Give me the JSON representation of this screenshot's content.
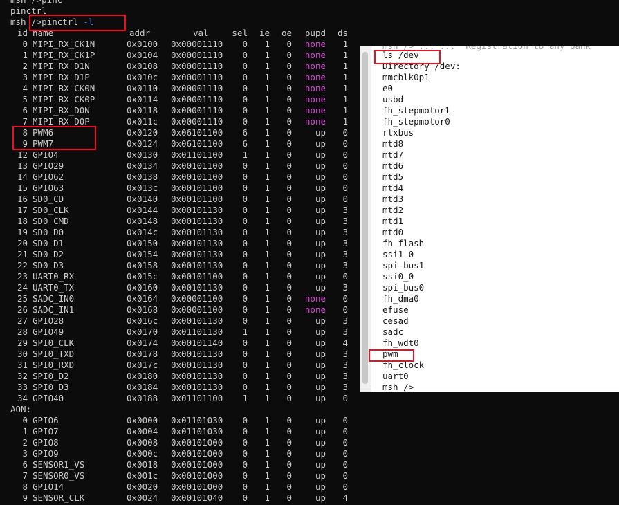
{
  "terminal": {
    "top_lines": [
      "msh />pinc",
      "pinctrl"
    ],
    "prompt": "msh ",
    "command_path": "/>pinctrl ",
    "command_flag": "-l",
    "header": [
      "id",
      "name",
      "addr",
      "val",
      "sel",
      "ie",
      "oe",
      "pupd",
      "ds"
    ],
    "rows": [
      [
        "0",
        "MIPI_RX_CK1N",
        "0x0100",
        "0x00001110",
        "0",
        "1",
        "0",
        "none",
        "1"
      ],
      [
        "1",
        "MIPI_RX_CK1P",
        "0x0104",
        "0x00001110",
        "0",
        "1",
        "0",
        "none",
        "1"
      ],
      [
        "2",
        "MIPI_RX_D1N",
        "0x0108",
        "0x00001110",
        "0",
        "1",
        "0",
        "none",
        "1"
      ],
      [
        "3",
        "MIPI_RX_D1P",
        "0x010c",
        "0x00001110",
        "0",
        "1",
        "0",
        "none",
        "1"
      ],
      [
        "4",
        "MIPI_RX_CK0N",
        "0x0110",
        "0x00001110",
        "0",
        "1",
        "0",
        "none",
        "1"
      ],
      [
        "5",
        "MIPI_RX_CK0P",
        "0x0114",
        "0x00001110",
        "0",
        "1",
        "0",
        "none",
        "1"
      ],
      [
        "6",
        "MIPI_RX_D0N",
        "0x0118",
        "0x00001110",
        "0",
        "1",
        "0",
        "none",
        "1"
      ],
      [
        "7",
        "MIPI_RX_D0P",
        "0x011c",
        "0x00001110",
        "0",
        "1",
        "0",
        "none",
        "1"
      ],
      [
        "8",
        "PWM6",
        "0x0120",
        "0x06101100",
        "6",
        "1",
        "0",
        "up",
        "0"
      ],
      [
        "9",
        "PWM7",
        "0x0124",
        "0x06101100",
        "6",
        "1",
        "0",
        "up",
        "0"
      ],
      [
        "12",
        "GPIO4",
        "0x0130",
        "0x01101100",
        "1",
        "1",
        "0",
        "up",
        "0"
      ],
      [
        "13",
        "GPIO29",
        "0x0134",
        "0x00101100",
        "0",
        "1",
        "0",
        "up",
        "0"
      ],
      [
        "14",
        "GPIO62",
        "0x0138",
        "0x00101100",
        "0",
        "1",
        "0",
        "up",
        "0"
      ],
      [
        "15",
        "GPIO63",
        "0x013c",
        "0x00101100",
        "0",
        "1",
        "0",
        "up",
        "0"
      ],
      [
        "16",
        "SD0_CD",
        "0x0140",
        "0x00101100",
        "0",
        "1",
        "0",
        "up",
        "0"
      ],
      [
        "17",
        "SD0_CLK",
        "0x0144",
        "0x00101130",
        "0",
        "1",
        "0",
        "up",
        "3"
      ],
      [
        "18",
        "SD0_CMD",
        "0x0148",
        "0x00101130",
        "0",
        "1",
        "0",
        "up",
        "3"
      ],
      [
        "19",
        "SD0_D0",
        "0x014c",
        "0x00101130",
        "0",
        "1",
        "0",
        "up",
        "3"
      ],
      [
        "20",
        "SD0_D1",
        "0x0150",
        "0x00101130",
        "0",
        "1",
        "0",
        "up",
        "3"
      ],
      [
        "21",
        "SD0_D2",
        "0x0154",
        "0x00101130",
        "0",
        "1",
        "0",
        "up",
        "3"
      ],
      [
        "22",
        "SD0_D3",
        "0x0158",
        "0x00101130",
        "0",
        "1",
        "0",
        "up",
        "3"
      ],
      [
        "23",
        "UART0_RX",
        "0x015c",
        "0x00101100",
        "0",
        "1",
        "0",
        "up",
        "0"
      ],
      [
        "24",
        "UART0_TX",
        "0x0160",
        "0x00101130",
        "0",
        "1",
        "0",
        "up",
        "3"
      ],
      [
        "25",
        "SADC_IN0",
        "0x0164",
        "0x00001100",
        "0",
        "1",
        "0",
        "none",
        "0"
      ],
      [
        "26",
        "SADC_IN1",
        "0x0168",
        "0x00001100",
        "0",
        "1",
        "0",
        "none",
        "0"
      ],
      [
        "27",
        "GPIO28",
        "0x016c",
        "0x00101130",
        "0",
        "1",
        "0",
        "up",
        "3"
      ],
      [
        "28",
        "GPIO49",
        "0x0170",
        "0x01101130",
        "1",
        "1",
        "0",
        "up",
        "3"
      ],
      [
        "29",
        "SPI0_CLK",
        "0x0174",
        "0x00101140",
        "0",
        "1",
        "0",
        "up",
        "4"
      ],
      [
        "30",
        "SPI0_TXD",
        "0x0178",
        "0x00101130",
        "0",
        "1",
        "0",
        "up",
        "3"
      ],
      [
        "31",
        "SPI0_RXD",
        "0x017c",
        "0x00101130",
        "0",
        "1",
        "0",
        "up",
        "3"
      ],
      [
        "32",
        "SPI0_D2",
        "0x0180",
        "0x00101130",
        "0",
        "1",
        "0",
        "up",
        "3"
      ],
      [
        "33",
        "SPI0_D3",
        "0x0184",
        "0x00101130",
        "0",
        "1",
        "0",
        "up",
        "3"
      ],
      [
        "34",
        "GPIO40",
        "0x0188",
        "0x01101100",
        "1",
        "1",
        "0",
        "up",
        "0"
      ]
    ],
    "aon_label": "AON:",
    "aon_rows": [
      [
        "0",
        "GPIO6",
        "0x0000",
        "0x01101030",
        "0",
        "1",
        "0",
        "up",
        "0"
      ],
      [
        "1",
        "GPIO7",
        "0x0004",
        "0x01101030",
        "0",
        "1",
        "0",
        "up",
        "0"
      ],
      [
        "2",
        "GPIO8",
        "0x0008",
        "0x00101000",
        "0",
        "1",
        "0",
        "up",
        "0"
      ],
      [
        "3",
        "GPIO9",
        "0x000c",
        "0x00101000",
        "0",
        "1",
        "0",
        "up",
        "0"
      ],
      [
        "6",
        "SENSOR1_VS",
        "0x0018",
        "0x00101000",
        "0",
        "1",
        "0",
        "up",
        "0"
      ],
      [
        "7",
        "SENSOR0_VS",
        "0x001c",
        "0x00101000",
        "0",
        "1",
        "0",
        "up",
        "0"
      ],
      [
        "8",
        "GPIO14",
        "0x0020",
        "0x00101000",
        "0",
        "1",
        "0",
        "up",
        "0"
      ],
      [
        "9",
        "SENSOR_CLK",
        "0x0024",
        "0x00101040",
        "0",
        "1",
        "0",
        "up",
        "4"
      ]
    ]
  },
  "dev_panel": {
    "cut_line": "msh /> ... ...  Registration to any bank",
    "command": "ls /dev",
    "listing_title": "Directory /dev:",
    "entries": [
      "mmcblk0p1",
      "e0",
      "usbd",
      "fh_stepmotor1",
      "fh_stepmotor0",
      "rtxbus",
      "mtd8",
      "mtd7",
      "mtd6",
      "mtd5",
      "mtd4",
      "mtd3",
      "mtd2",
      "mtd1",
      "mtd0",
      "fh_flash",
      "ssi1_0",
      "spi_bus1",
      "ssi0_0",
      "spi_bus0",
      "fh_dma0",
      "efuse",
      "cesad",
      "sadc",
      "fh_wdt0",
      "pwm",
      "fh_clock",
      "uart0"
    ],
    "end_prompt": "msh />"
  },
  "colors": {
    "terminal_bg": "#0c0c0c",
    "text": "#cccccc",
    "none_text": "#d64ad6",
    "flag_text": "#4a7cd6",
    "highlight_box": "#e81123",
    "panel_bg": "#ffffff"
  }
}
